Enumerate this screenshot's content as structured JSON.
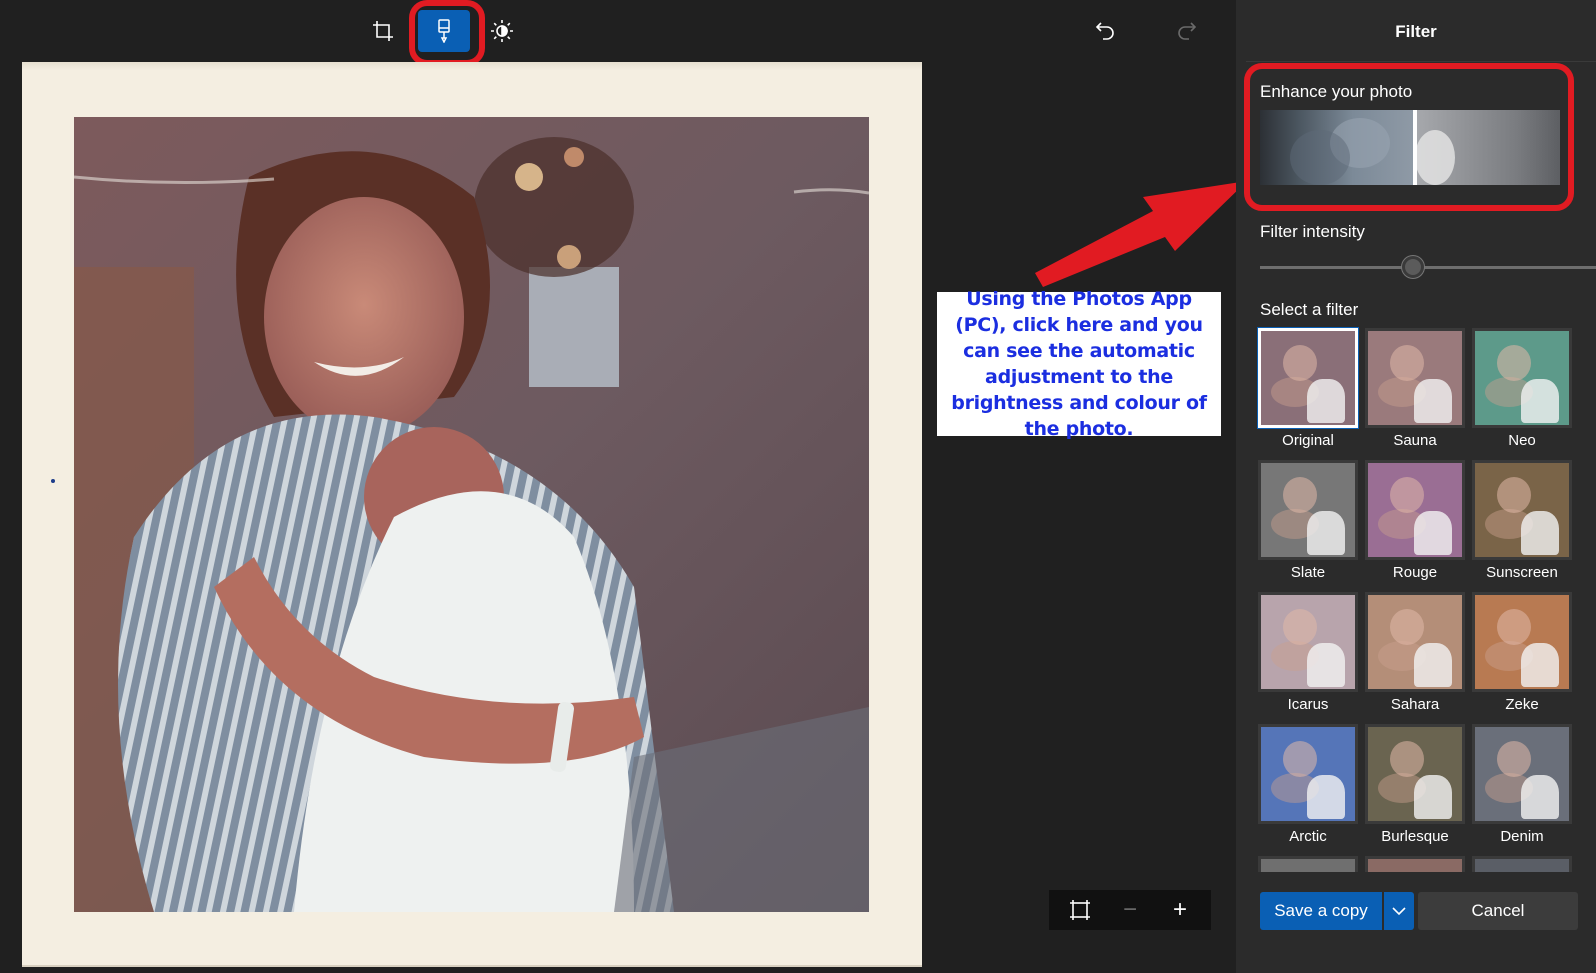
{
  "toolbar": {
    "tools": [
      "crop-icon",
      "filter-brush-icon",
      "brightness-icon"
    ],
    "active_tool": "filter-brush-icon",
    "history": [
      "undo-icon",
      "redo-icon"
    ]
  },
  "callout": {
    "text": "Using the Photos App (PC), click here and you can see the automatic adjustment to the brightness and colour of the photo."
  },
  "zoom_controls": {
    "fit": "fit-to-window-icon",
    "zoom_out": "−",
    "zoom_in": "+"
  },
  "panel": {
    "title": "Filter",
    "enhance_label": "Enhance your photo",
    "intensity_label": "Filter intensity",
    "intensity_value_fraction": 0.45,
    "select_label": "Select a filter",
    "filters": [
      {
        "name": "Original",
        "tint": "#8a6f78",
        "selected": true
      },
      {
        "name": "Sauna",
        "tint": "#9a7a7c"
      },
      {
        "name": "Neo",
        "tint": "#5d9a8a"
      },
      {
        "name": "Slate",
        "tint": "#777777"
      },
      {
        "name": "Rouge",
        "tint": "#9a6e94"
      },
      {
        "name": "Sunscreen",
        "tint": "#7a6448"
      },
      {
        "name": "Icarus",
        "tint": "#b8a4ac"
      },
      {
        "name": "Sahara",
        "tint": "#b48e78"
      },
      {
        "name": "Zeke",
        "tint": "#b87a52"
      },
      {
        "name": "Arctic",
        "tint": "#5575b8"
      },
      {
        "name": "Burlesque",
        "tint": "#6a6450"
      },
      {
        "name": "Denim",
        "tint": "#6a6f7a"
      }
    ],
    "save_label": "Save a copy",
    "cancel_label": "Cancel"
  },
  "colors": {
    "accent": "#0a5fb4",
    "highlight_ring": "#e11b22",
    "callout_text": "#1b2ee0",
    "background": "#202020",
    "panel": "#2b2b2b"
  }
}
